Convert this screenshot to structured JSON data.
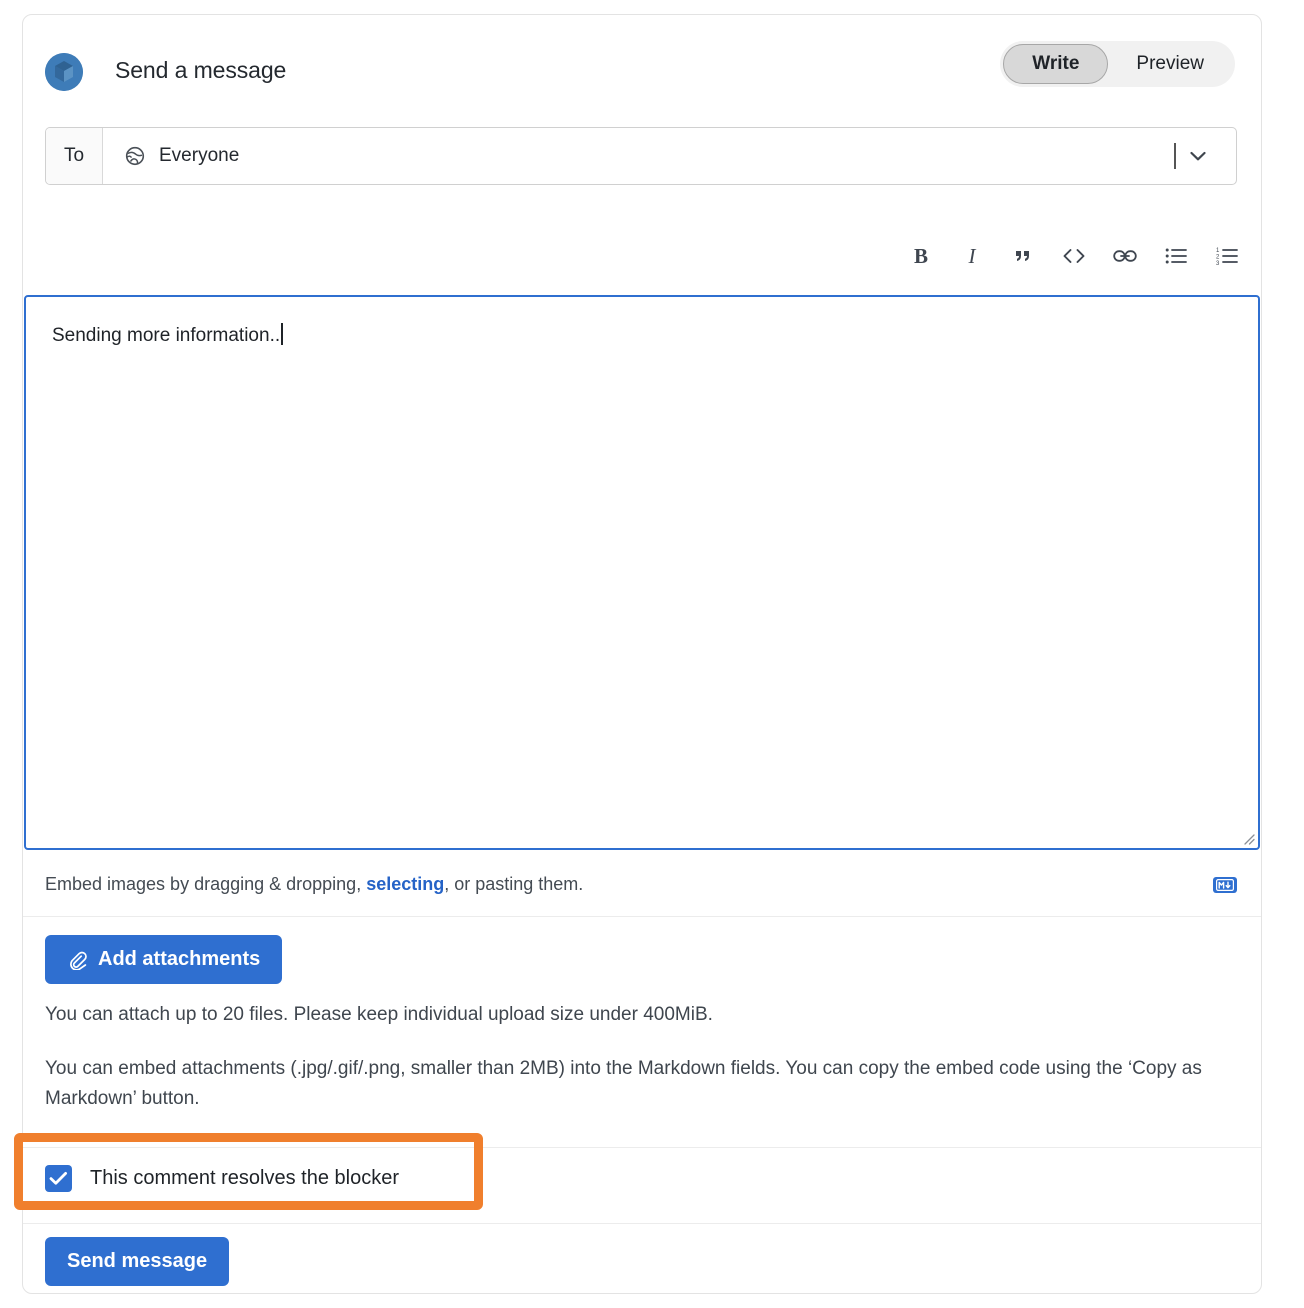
{
  "header": {
    "title": "Send a message",
    "avatar_icon": "user-avatar-cube-icon",
    "toggle": {
      "write_label": "Write",
      "preview_label": "Preview",
      "active": "Write"
    }
  },
  "recipient": {
    "label": "To",
    "value": "Everyone",
    "audience_icon": "globe-icon",
    "dropdown_icon": "chevron-down-icon"
  },
  "toolbar": {
    "items": [
      {
        "name": "bold-icon",
        "glyph": "B",
        "title": "Bold"
      },
      {
        "name": "italic-icon",
        "glyph": "I",
        "title": "Italic"
      },
      {
        "name": "quote-icon",
        "glyph": "”",
        "title": "Quote"
      },
      {
        "name": "code-icon",
        "glyph": "<>",
        "title": "Code"
      },
      {
        "name": "link-icon",
        "glyph": "⍐",
        "title": "Link"
      },
      {
        "name": "bulleted-list-icon",
        "glyph": "≡",
        "title": "Bulleted list"
      },
      {
        "name": "numbered-list-icon",
        "glyph": "≡",
        "title": "Numbered list"
      }
    ]
  },
  "editor": {
    "value": "Sending more information..",
    "placeholder": ""
  },
  "embed_hint": {
    "before": "Embed images by dragging & dropping, ",
    "link": "selecting",
    "after": ", or pasting them.",
    "markdown_badge": "markdown-icon",
    "markdown_badge_label": "M↓"
  },
  "attachments": {
    "button_label": "Add attachments",
    "button_icon": "paperclip-icon",
    "info_line_1": "You can attach up to 20 files. Please keep individual upload size under 400MiB.",
    "info_line_2": "You can embed attachments (.jpg/.gif/.png, smaller than 2MB) into the Markdown fields. You can copy the embed code using the ‘Copy as Markdown’ button."
  },
  "resolve": {
    "label": "This comment resolves the blocker",
    "checked": true,
    "check_icon": "checkmark-icon"
  },
  "submit": {
    "label": "Send message"
  },
  "annotation": {
    "highlight_color": "#f07f2d",
    "target": "resolve-blocker-checkbox-row"
  },
  "colors": {
    "primary_blue": "#2f6fd0",
    "focus_border": "#2f6fd0",
    "link_blue": "#2563c7",
    "highlight_orange": "#f07f2d",
    "text": "#1f2328"
  }
}
